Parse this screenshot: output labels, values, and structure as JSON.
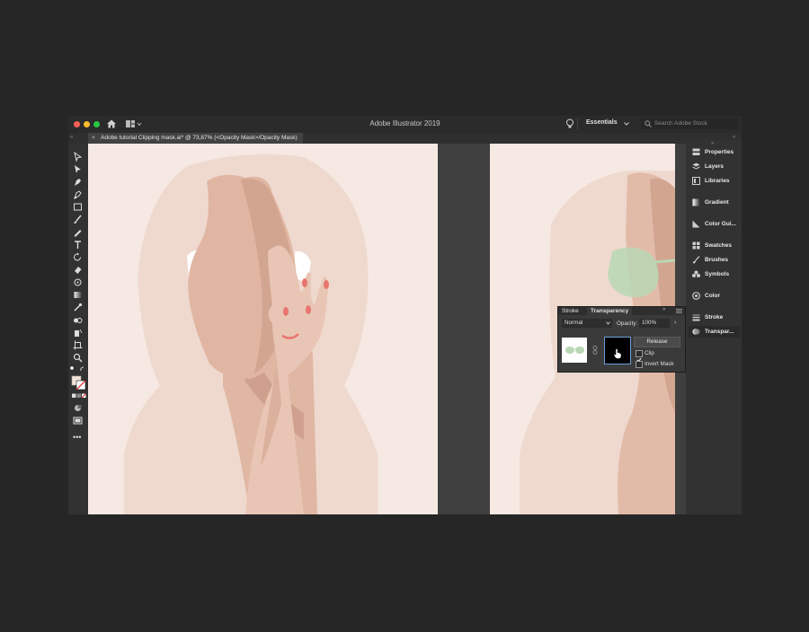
{
  "app": {
    "title": "Adobe Illustrator 2019",
    "workspace": "Essentials",
    "search_placeholder": "Search Adobe Stock"
  },
  "document_tab": {
    "title": "Adobe tutorial Clipping mask.ai* @ 73,87% (<Opacity Mask>/Opacity Mask)",
    "close": "×"
  },
  "colors": {
    "accent_close": "#ff5f57",
    "accent_min": "#febc2e",
    "accent_max": "#28c840",
    "artboard_bg": "#f6e9e3"
  },
  "right_panels": [
    {
      "label": "Properties",
      "icon": "properties-icon"
    },
    {
      "label": "Layers",
      "icon": "layers-icon"
    },
    {
      "label": "Libraries",
      "icon": "libraries-icon"
    },
    {
      "label": "Gradient",
      "icon": "gradient-icon"
    },
    {
      "label": "Color Gui...",
      "icon": "color-guide-icon"
    },
    {
      "label": "Swatches",
      "icon": "swatches-icon"
    },
    {
      "label": "Brushes",
      "icon": "brushes-icon"
    },
    {
      "label": "Symbols",
      "icon": "symbols-icon"
    },
    {
      "label": "Color",
      "icon": "color-icon"
    },
    {
      "label": "Stroke",
      "icon": "stroke-icon"
    },
    {
      "label": "Transpar...",
      "icon": "transparency-icon"
    }
  ],
  "transparency_panel": {
    "tabs": [
      "Stroke",
      "Transparency"
    ],
    "blend_mode": "Normal",
    "opacity_label": "Opacity:",
    "opacity_value": "100%",
    "release_label": "Release",
    "clip_label": "Clip",
    "clip_checked": true,
    "invert_label": "Invert Mask",
    "invert_checked": false
  }
}
